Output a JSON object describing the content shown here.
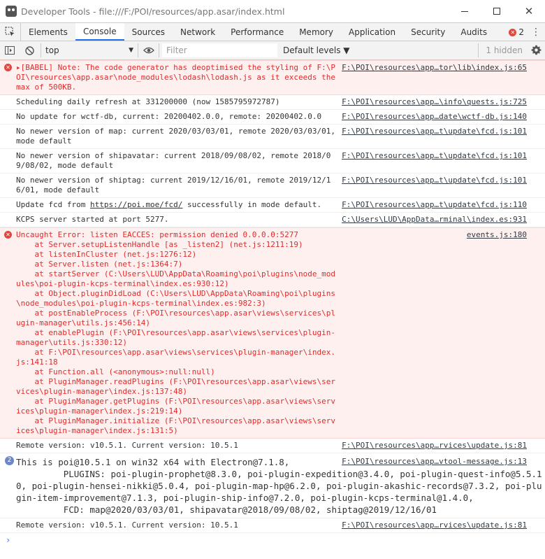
{
  "window": {
    "title": "Developer Tools - file:///F:/POI/resources/app.asar/index.html",
    "close_glyph": "✕"
  },
  "tabs": [
    {
      "label": "Elements"
    },
    {
      "label": "Console"
    },
    {
      "label": "Sources"
    },
    {
      "label": "Network"
    },
    {
      "label": "Performance"
    },
    {
      "label": "Memory"
    },
    {
      "label": "Application"
    },
    {
      "label": "Security"
    },
    {
      "label": "Audits"
    }
  ],
  "error_count": "2",
  "toolbar": {
    "context": "top",
    "filter_placeholder": "Filter",
    "levels": "Default levels ▼",
    "hidden": "1 hidden"
  },
  "messages": [
    {
      "text": "▸[BABEL] Note: The code generator has deoptimised the styling of F:\\POI\\resources\\app.asar\\node_modules\\lodash\\lodash.js as it exceeds the max of 500KB.",
      "src": "F:\\POI\\resources\\app…tor\\lib\\index.js:65"
    },
    {
      "text": "Scheduling daily refresh at 331200000 (now 1585795972787)",
      "src": "F:\\POI\\resources\\app…\\info\\quests.js:725"
    },
    {
      "text": "No update for wctf-db, current: 20200402.0.0, remote: 20200402.0.0",
      "src": "F:\\POI\\resources\\app…date\\wctf-db.js:140"
    },
    {
      "text": "No newer version of map: current 2020/03/03/01, remote 2020/03/03/01, mode default",
      "src": "F:\\POI\\resources\\app…t\\update\\fcd.js:101"
    },
    {
      "text": "No newer version of shipavatar: current 2018/09/08/02, remote 2018/09/08/02, mode default",
      "src": "F:\\POI\\resources\\app…t\\update\\fcd.js:101"
    },
    {
      "text": "No newer version of shiptag: current 2019/12/16/01, remote 2019/12/16/01, mode default",
      "src": "F:\\POI\\resources\\app…t\\update\\fcd.js:101"
    },
    {
      "text_before": "Update fcd from ",
      "link": "https://poi.moe/fcd/",
      "text_after": " successfully in mode default.",
      "src": "F:\\POI\\resources\\app…t\\update\\fcd.js:110"
    },
    {
      "text": "KCPS server started at port 5277.",
      "src": "C:\\Users\\LUD\\AppData…rminal\\index.es:931"
    },
    {
      "text": "Uncaught Error: listen EACCES: permission denied 0.0.0.0:5277\n    at Server.setupListenHandle [as _listen2] (net.js:1211:19)\n    at listenInCluster (net.js:1276:12)\n    at Server.listen (net.js:1364:7)\n    at startServer (C:\\Users\\LUD\\AppData\\Roaming\\poi\\plugins\\node_modules\\poi-plugin-kcps-terminal\\index.es:930:12)\n    at Object.pluginDidLoad (C:\\Users\\LUD\\AppData\\Roaming\\poi\\plugins\\node_modules\\poi-plugin-kcps-terminal\\index.es:982:3)\n    at postEnableProcess (F:\\POI\\resources\\app.asar\\views\\services\\plugin-manager\\utils.js:456:14)\n    at enablePlugin (F:\\POI\\resources\\app.asar\\views\\services\\plugin-manager\\utils.js:330:12)\n    at F:\\POI\\resources\\app.asar\\views\\services\\plugin-manager\\index.js:141:18\n    at Function.all (<anonymous>:null:null)\n    at PluginManager.readPlugins (F:\\POI\\resources\\app.asar\\views\\services\\plugin-manager\\index.js:137:48)\n    at PluginManager.getPlugins (F:\\POI\\resources\\app.asar\\views\\services\\plugin-manager\\index.js:219:14)\n    at PluginManager.initialize (F:\\POI\\resources\\app.asar\\views\\services\\plugin-manager\\index.js:131:5)",
      "src": "events.js:180"
    },
    {
      "text": "Remote version: v10.5.1. Current version: 10.5.1",
      "src": "F:\\POI\\resources\\app…rvices\\update.js:81"
    },
    {
      "count": "2",
      "text": "This is poi@10.5.1 on win32 x64 with Electron@7.1.8,\n         PLUGINS: poi-plugin-prophet@8.3.0, poi-plugin-expedition@3.4.0, poi-plugin-quest-info@5.5.10, poi-plugin-hensei-nikki@5.0.4, poi-plugin-map-hp@6.2.0, poi-plugin-akashic-records@7.3.2, poi-plugin-item-improvement@7.1.3, poi-plugin-ship-info@7.2.0, poi-plugin-kcps-terminal@1.4.0,\n         FCD: map@2020/03/03/01, shipavatar@2018/09/08/02, shiptag@2019/12/16/01",
      "src": "F:\\POI\\resources\\app…vtool-message.js:13"
    },
    {
      "text": "Remote version: v10.5.1. Current version: 10.5.1",
      "src": "F:\\POI\\resources\\app…rvices\\update.js:81"
    }
  ],
  "prompt": "›",
  "colors": {
    "accent": "#1a73e8",
    "error_bg": "#fff0f0",
    "error_text": "#e02b2b"
  }
}
